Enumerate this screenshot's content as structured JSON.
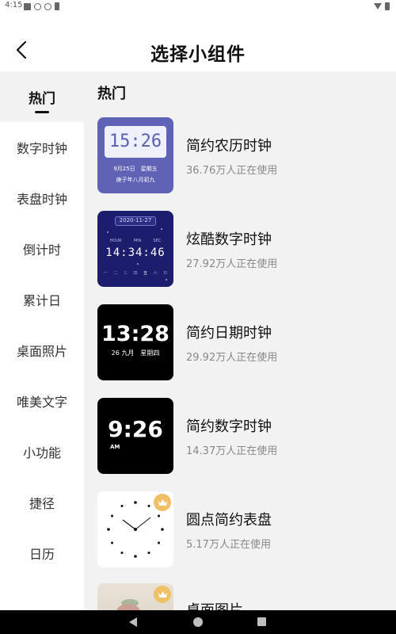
{
  "status_bar": {
    "time": "4:15"
  },
  "header": {
    "title": "选择小组件",
    "back_icon": "chevron-left-icon"
  },
  "sidebar": {
    "items": [
      {
        "label": "热门",
        "active": true
      },
      {
        "label": "数字时钟"
      },
      {
        "label": "表盘时钟"
      },
      {
        "label": "倒计时"
      },
      {
        "label": "累计日"
      },
      {
        "label": "桌面照片"
      },
      {
        "label": "唯美文字"
      },
      {
        "label": "小功能"
      },
      {
        "label": "捷径"
      },
      {
        "label": "日历"
      }
    ]
  },
  "main": {
    "section_title": "热门",
    "widgets": [
      {
        "name": "简约农历时钟",
        "usage": "36.76万人正在使用",
        "preview": {
          "time": "15:26",
          "date": "9月25日　星期五",
          "lunar": "庚子年八月初九"
        },
        "colors": {
          "bg": "#6063b5"
        }
      },
      {
        "name": "炫酷数字时钟",
        "usage": "27.92万人正在使用",
        "preview": {
          "date": "2020-11-27",
          "hour": "HOUR",
          "min": "MIN",
          "sec": "SEC",
          "time": "14:34:46",
          "weekdays": [
            "一",
            "二",
            "三",
            "四",
            "五",
            "六",
            "日"
          ]
        },
        "colors": {
          "bg": "#1d1d6e"
        }
      },
      {
        "name": "简约日期时钟",
        "usage": "29.92万人正在使用",
        "preview": {
          "time": "13:28",
          "date": "26 九月　星期四"
        },
        "colors": {
          "bg": "#000000"
        }
      },
      {
        "name": "简约数字时钟",
        "usage": "14.37万人正在使用",
        "preview": {
          "time": "9:26",
          "ampm": "AM"
        },
        "colors": {
          "bg": "#000000"
        }
      },
      {
        "name": "圆点简约表盘",
        "usage": "5.17万人正在使用",
        "premium": true,
        "premium_icon": "crown-icon",
        "colors": {
          "bg": "#ffffff",
          "crown": "#f0c066"
        }
      },
      {
        "name": "桌面图片",
        "usage": "",
        "premium": true,
        "premium_icon": "crown-icon"
      }
    ]
  },
  "nav_bar": {
    "back_icon": "triangle-back-icon",
    "home_icon": "circle-home-icon",
    "recent_icon": "square-recent-icon"
  }
}
